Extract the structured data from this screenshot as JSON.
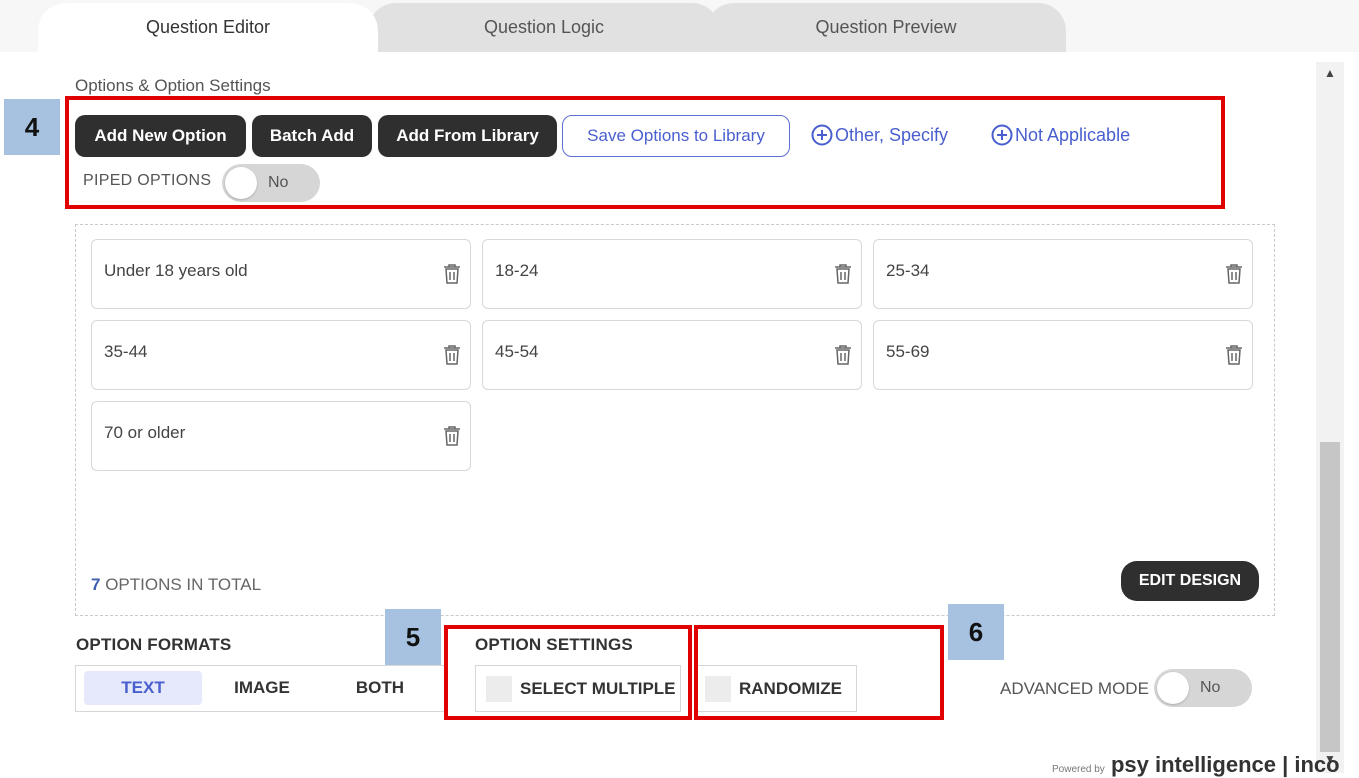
{
  "tabs": [
    {
      "label": "Question Editor",
      "active": true
    },
    {
      "label": "Question Logic",
      "active": false
    },
    {
      "label": "Question Preview",
      "active": false
    }
  ],
  "section_title": "Options & Option Settings",
  "toolbar": {
    "add_new_option": "Add New Option",
    "batch_add": "Batch Add",
    "add_from_library": "Add From Library",
    "save_options_to_library": "Save Options to Library",
    "other_specify": "Other, Specify",
    "not_applicable": "Not Applicable"
  },
  "piped_options": {
    "label": "PIPED OPTIONS",
    "toggle_value": "No"
  },
  "options": [
    "Under 18 years old",
    "18-24",
    "25-34",
    "35-44",
    "45-54",
    "55-69",
    "70 or older"
  ],
  "options_total": {
    "count": "7",
    "suffix": "OPTIONS IN TOTAL"
  },
  "edit_design": "EDIT DESIGN",
  "option_formats": {
    "title": "OPTION FORMATS",
    "items": [
      "TEXT",
      "IMAGE",
      "BOTH"
    ],
    "selected": "TEXT"
  },
  "option_settings": {
    "title": "OPTION SETTINGS",
    "select_multiple": "SELECT MULTIPLE",
    "randomize": "RANDOMIZE"
  },
  "advanced_mode": {
    "label": "ADVANCED MODE",
    "toggle_value": "No"
  },
  "annotations": {
    "box4": "4",
    "box5": "5",
    "box6": "6"
  },
  "footer": {
    "powered_by": "Powered by",
    "brand": "psy intelligence | inco"
  },
  "colors": {
    "accent": "#4a5fcf",
    "annotation_red": "#e00000",
    "annotation_label_bg": "#a7c2e0",
    "dark_button": "#2f2f2f"
  },
  "icons": {
    "plus": "plus-circle-icon",
    "trash": "trash-icon",
    "scroll_up": "scroll-up-arrow-icon",
    "scroll_down": "scroll-down-arrow-icon"
  }
}
